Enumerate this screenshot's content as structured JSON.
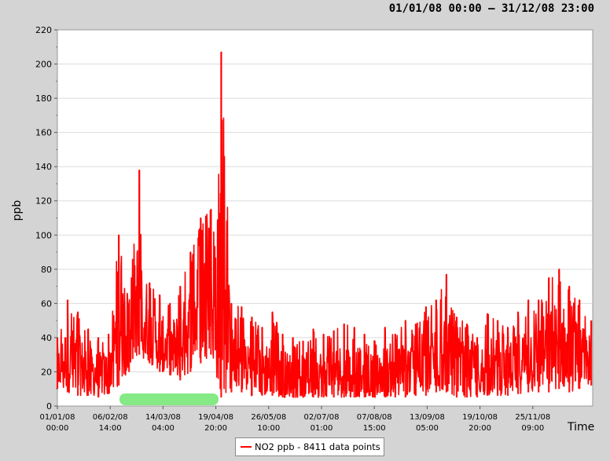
{
  "header": {
    "range": "01/01/08 00:00  –  31/12/08 23:00"
  },
  "legend": {
    "label": "NO2 ppb - 8411 data points"
  },
  "colors": {
    "series": "#ff0000",
    "plot_background": "#ffffff",
    "window_background": "#d4d4d4",
    "highlight": "#7ee87e"
  },
  "chart_data": {
    "type": "line",
    "title": "01/01/08 00:00  –  31/12/08 23:00",
    "xlabel": "Time",
    "ylabel": "ppb",
    "xlim": [
      "01/01/08 00:00",
      "31/12/08 23:00"
    ],
    "ylim": [
      0,
      220
    ],
    "yticks": [
      0,
      20,
      40,
      60,
      80,
      100,
      120,
      140,
      160,
      180,
      200,
      220
    ],
    "xtick_labels": [
      [
        "01/01/08",
        "00:00"
      ],
      [
        "06/02/08",
        "14:00"
      ],
      [
        "14/03/08",
        "04:00"
      ],
      [
        "19/04/08",
        "20:00"
      ],
      [
        "26/05/08",
        "10:00"
      ],
      [
        "02/07/08",
        "01:00"
      ],
      [
        "07/08/08",
        "15:00"
      ],
      [
        "13/09/08",
        "05:00"
      ],
      [
        "19/10/08",
        "20:00"
      ],
      [
        "25/11/08",
        "09:00"
      ]
    ],
    "grid": true,
    "legend_position": "bottom-center",
    "series": [
      {
        "name": "NO2 ppb - 8411 data points",
        "color": "#ff0000",
        "x": [
          "01/01/08",
          "08/01/08",
          "15/01/08",
          "22/01/08",
          "29/01/08",
          "05/02/08",
          "12/02/08",
          "19/02/08",
          "26/02/08",
          "04/03/08",
          "11/03/08",
          "18/03/08",
          "25/03/08",
          "01/04/08",
          "08/04/08",
          "15/04/08",
          "22/04/08",
          "29/04/08",
          "06/05/08",
          "13/05/08",
          "20/05/08",
          "27/05/08",
          "03/06/08",
          "10/06/08",
          "17/06/08",
          "24/06/08",
          "01/07/08",
          "08/07/08",
          "15/07/08",
          "22/07/08",
          "29/07/08",
          "05/08/08",
          "12/08/08",
          "19/08/08",
          "26/08/08",
          "02/09/08",
          "09/09/08",
          "16/09/08",
          "23/09/08",
          "30/09/08",
          "07/10/08",
          "14/10/08",
          "21/10/08",
          "28/10/08",
          "04/11/08",
          "11/11/08",
          "18/11/08",
          "25/11/08",
          "02/12/08",
          "09/12/08",
          "16/12/08",
          "23/12/08",
          "31/12/08"
        ],
        "high": [
          40,
          62,
          55,
          45,
          40,
          42,
          100,
          60,
          138,
          72,
          65,
          60,
          70,
          90,
          110,
          115,
          207,
          60,
          58,
          52,
          46,
          55,
          42,
          40,
          38,
          45,
          42,
          44,
          48,
          46,
          42,
          38,
          46,
          42,
          50,
          48,
          58,
          62,
          77,
          52,
          48,
          40,
          54,
          50,
          46,
          55,
          62,
          62,
          75,
          80,
          70,
          62,
          50
        ],
        "low": [
          10,
          8,
          6,
          6,
          5,
          7,
          12,
          20,
          30,
          25,
          20,
          18,
          15,
          20,
          25,
          30,
          5,
          8,
          8,
          6,
          6,
          6,
          5,
          5,
          5,
          5,
          5,
          5,
          5,
          5,
          5,
          5,
          5,
          5,
          5,
          6,
          6,
          8,
          8,
          5,
          5,
          5,
          6,
          6,
          6,
          7,
          8,
          8,
          8,
          10,
          8,
          10,
          12
        ],
        "typical": [
          22,
          28,
          26,
          22,
          20,
          24,
          45,
          40,
          60,
          48,
          42,
          40,
          45,
          55,
          65,
          70,
          85,
          25,
          24,
          22,
          20,
          22,
          18,
          17,
          17,
          18,
          18,
          18,
          19,
          18,
          17,
          16,
          18,
          18,
          20,
          20,
          24,
          28,
          30,
          22,
          20,
          18,
          22,
          22,
          22,
          26,
          30,
          30,
          34,
          38,
          34,
          30,
          26
        ]
      }
    ]
  }
}
